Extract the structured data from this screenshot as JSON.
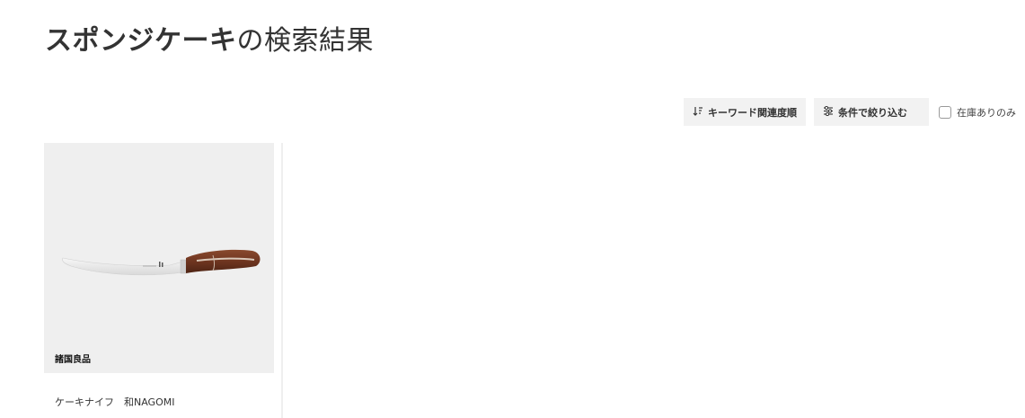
{
  "search": {
    "keyword": "スポンジケーキ",
    "title_suffix": "の検索結果"
  },
  "toolbar": {
    "sort_label": "キーワード関連度順",
    "sort_icon": "sort-icon",
    "filter_label": "条件で絞り込む",
    "filter_icon": "sliders-icon",
    "in_stock_label": "在庫ありのみ",
    "in_stock_checked": false
  },
  "products": [
    {
      "brand": "諸国良品",
      "name": "ケーキナイフ　和NAGOMI",
      "image_icon": "knife-image"
    }
  ],
  "colors": {
    "button_bg": "#f2f2f2",
    "image_bg": "#efefef",
    "text": "#333333"
  }
}
